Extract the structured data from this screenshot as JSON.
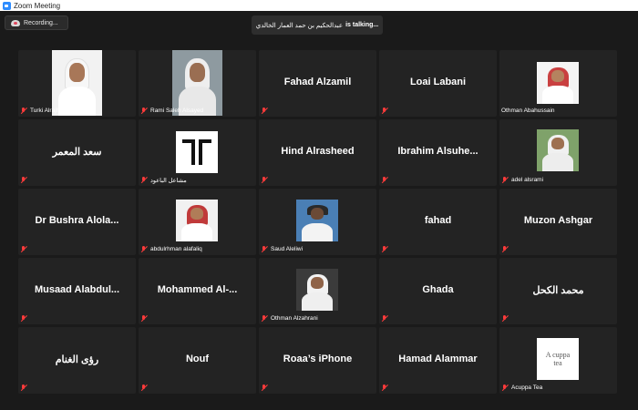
{
  "window": {
    "title": "Zoom Meeting"
  },
  "recording": {
    "label": "Recording..."
  },
  "talking": {
    "name": "عبدالحكيم بن حمد العمار الخالدي",
    "suffix": "is  talking..."
  },
  "colors": {
    "background": "#1a1a1a",
    "tile": "#232323",
    "muted_mic": "#ff3b3b",
    "title_icon": "#2d8cff"
  },
  "participants": [
    {
      "name": "Turki Alrajhi",
      "display": "photo",
      "muted": true
    },
    {
      "name": "Rami Saleh Alsayed",
      "display": "photo",
      "muted": true
    },
    {
      "name": "Fahad Alzamil",
      "display": "name",
      "muted": true
    },
    {
      "name": "Loai Labani",
      "display": "name",
      "muted": true
    },
    {
      "name": "Othman Abahussain",
      "display": "photo",
      "muted": true
    },
    {
      "name": "سعد المعمر",
      "display": "name",
      "muted": true
    },
    {
      "name": "مشاعل الباعود",
      "display": "logo",
      "muted": true
    },
    {
      "name": "Hind Alrasheed",
      "display": "name",
      "muted": true
    },
    {
      "name": "Ibrahim  Alsuhe...",
      "display": "name",
      "muted": true
    },
    {
      "name": "adel alsrami",
      "display": "photo",
      "muted": true
    },
    {
      "name": "Dr Bushra  Alola...",
      "display": "name",
      "muted": true
    },
    {
      "name": "abdulrhman alafaliq",
      "display": "photo",
      "muted": true
    },
    {
      "name": "Saud Aleliwi",
      "display": "photo",
      "muted": true
    },
    {
      "name": "fahad",
      "display": "name",
      "muted": true
    },
    {
      "name": "Muzon Ashgar",
      "display": "name",
      "muted": true
    },
    {
      "name": "Musaad  Alabdul...",
      "display": "name",
      "muted": true
    },
    {
      "name": "Mohammed  Al-...",
      "display": "name",
      "muted": true
    },
    {
      "name": "Othman Alzahrani",
      "display": "photo",
      "muted": true
    },
    {
      "name": "Ghada",
      "display": "name",
      "muted": true
    },
    {
      "name": "محمد الكحل",
      "display": "name",
      "muted": true
    },
    {
      "name": "رؤى الغنام",
      "display": "name",
      "muted": true
    },
    {
      "name": "Nouf",
      "display": "name",
      "muted": true
    },
    {
      "name": "Roaa’s iPhone",
      "display": "name",
      "muted": true
    },
    {
      "name": "Hamad Alammar",
      "display": "name",
      "muted": true
    },
    {
      "name": "Acuppa Tea",
      "display": "logo",
      "muted": true
    }
  ],
  "logos": {
    "acuppa_line1": "A cuppa",
    "acuppa_line2": "tea"
  }
}
